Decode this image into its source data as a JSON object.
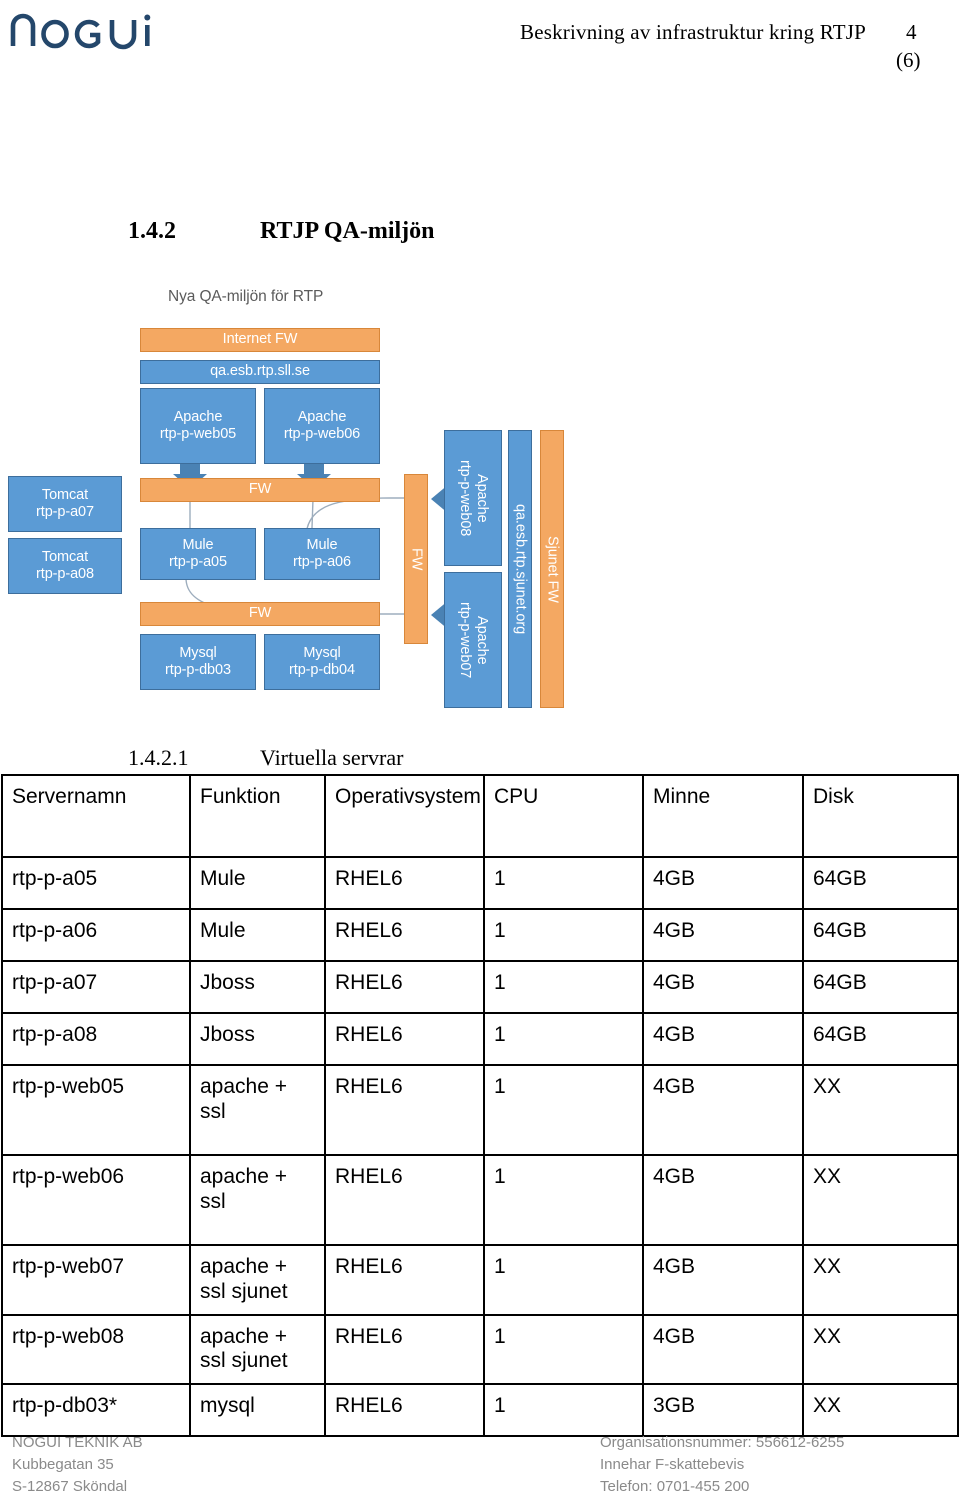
{
  "header": {
    "logo_text": "nogui",
    "doc_title": "Beskrivning av infrastruktur kring RTJP",
    "page_number": "4",
    "page_total": "(6)"
  },
  "sections": {
    "s142_number": "1.4.2",
    "s142_title": "RTJP QA-miljön",
    "s1421_number": "1.4.2.1",
    "s1421_title": "Virtuella servrar"
  },
  "diagram": {
    "title": "Nya QA-miljön för RTP",
    "colors": {
      "blue_fill": "#5b9bd5",
      "blue_border": "#3d6e9c",
      "orange_fill": "#f4a862",
      "orange_border": "#d8873a",
      "arrow_fill": "#4a82b4",
      "connector_line": "#9dadbd",
      "text": "#ffffff",
      "title_text": "#5b5b5b"
    },
    "nodes": {
      "internet_fw": "Internet FW",
      "qa_esb_rtp_sll_se": "qa.esb.rtp.sll.se",
      "apache_web05_l1": "Apache",
      "apache_web05_l2": "rtp-p-web05",
      "apache_web06_l1": "Apache",
      "apache_web06_l2": "rtp-p-web06",
      "fw_mid": "FW",
      "fw_low": "FW",
      "tomcat_a07_l1": "Tomcat",
      "tomcat_a07_l2": "rtp-p-a07",
      "tomcat_a08_l1": "Tomcat",
      "tomcat_a08_l2": "rtp-p-a08",
      "mule_a05_l1": "Mule",
      "mule_a05_l2": "rtp-p-a05",
      "mule_a06_l1": "Mule",
      "mule_a06_l2": "rtp-p-a06",
      "mysql_db03_l1": "Mysql",
      "mysql_db03_l2": "rtp-p-db03",
      "mysql_db04_l1": "Mysql",
      "mysql_db04_l2": "rtp-p-db04",
      "fw_vertical": "FW",
      "apache_web08_l1": "Apache",
      "apache_web08_l2": "rtp-p-web08",
      "apache_web07_l1": "Apache",
      "apache_web07_l2": "rtp-p-web07",
      "qa_esb_rtp_sjunet_org": "qa.esb.rtp.sjunet.org",
      "sjunet_fw": "Sjunet FW"
    }
  },
  "table": {
    "headers": [
      "Servernamn",
      "Funktion",
      "Operativsystem",
      "CPU",
      "Minne",
      "Disk"
    ],
    "rows": [
      {
        "server": "rtp-p-a05",
        "funktion": "Mule",
        "os": "RHEL6",
        "cpu": "1",
        "minne": "4GB",
        "disk": "64GB",
        "tall": false
      },
      {
        "server": "rtp-p-a06",
        "funktion": "Mule",
        "os": "RHEL6",
        "cpu": "1",
        "minne": "4GB",
        "disk": "64GB",
        "tall": false
      },
      {
        "server": "rtp-p-a07",
        "funktion": "Jboss",
        "os": "RHEL6",
        "cpu": "1",
        "minne": "4GB",
        "disk": "64GB",
        "tall": false
      },
      {
        "server": "rtp-p-a08",
        "funktion": "Jboss",
        "os": "RHEL6",
        "cpu": "1",
        "minne": "4GB",
        "disk": "64GB",
        "tall": false
      },
      {
        "server": "rtp-p-web05",
        "funktion": "apache + ssl",
        "os": "RHEL6",
        "cpu": "1",
        "minne": "4GB",
        "disk": "XX",
        "tall": true
      },
      {
        "server": "rtp-p-web06",
        "funktion": "apache + ssl",
        "os": "RHEL6",
        "cpu": "1",
        "minne": "4GB",
        "disk": "XX",
        "tall": true
      },
      {
        "server": "rtp-p-web07",
        "funktion": "apache + ssl sjunet",
        "os": "RHEL6",
        "cpu": "1",
        "minne": "4GB",
        "disk": "XX",
        "tall": false
      },
      {
        "server": "rtp-p-web08",
        "funktion": "apache + ssl sjunet",
        "os": "RHEL6",
        "cpu": "1",
        "minne": "4GB",
        "disk": "XX",
        "tall": false
      },
      {
        "server": "rtp-p-db03*",
        "funktion": "mysql",
        "os": "RHEL6",
        "cpu": "1",
        "minne": "3GB",
        "disk": "XX",
        "tall": false
      }
    ]
  },
  "footer": {
    "left": [
      "NOGUI TEKNIK AB",
      "Kubbegatan 35",
      "S-12867 Sköndal"
    ],
    "right": [
      "Organisationsnummer: 556612-6255",
      "Innehar F-skattebevis",
      "Telefon: 0701-455 200"
    ]
  }
}
